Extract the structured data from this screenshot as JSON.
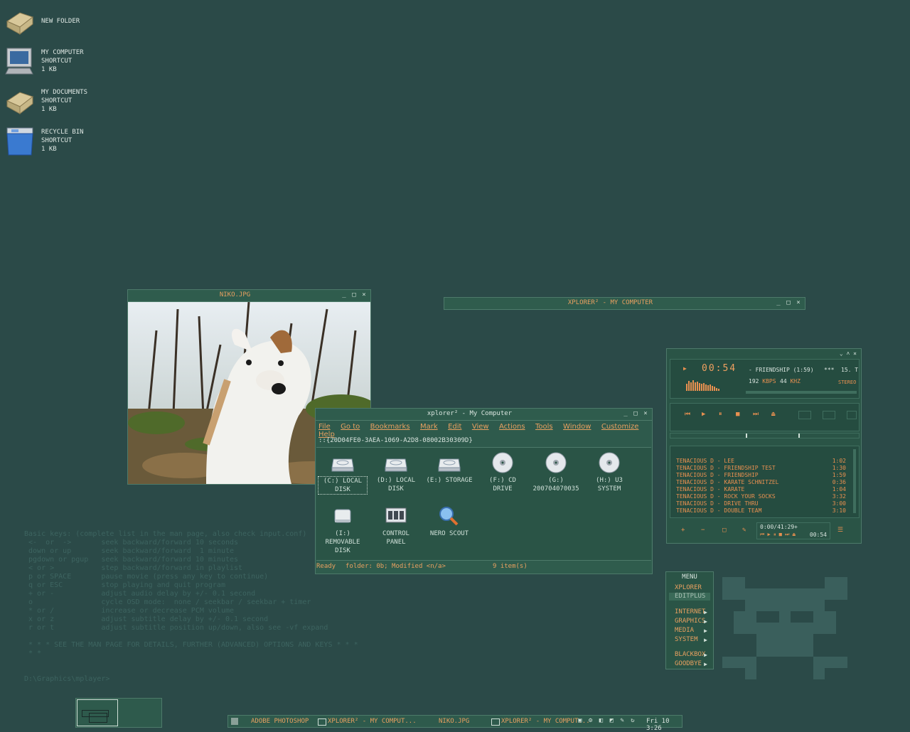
{
  "desktop_icons": [
    {
      "name": "New Folder",
      "lines": [
        "New Folder"
      ]
    },
    {
      "name": "My Computer",
      "lines": [
        "My Computer",
        "Shortcut",
        "1 KB"
      ]
    },
    {
      "name": "My Documents",
      "lines": [
        "My Documents",
        "Shortcut",
        "1 KB"
      ]
    },
    {
      "name": "Recycle Bin",
      "lines": [
        "Recycle Bin",
        "Shortcut",
        "1 KB"
      ]
    }
  ],
  "image_window": {
    "title": "niko.jpg"
  },
  "xplorer_collapsed": {
    "title": "xplorer² - My Computer"
  },
  "xplorer": {
    "title": "xplorer² - My Computer",
    "menu": [
      "File",
      "Go to",
      "Bookmarks",
      "Mark",
      "Edit",
      "View",
      "Actions",
      "Tools",
      "Window",
      "Customize",
      "Help"
    ],
    "address": "::{20D04FE0-3AEA-1069-A2D8-08002B30309D}",
    "drives": [
      {
        "label": "(C:) Local Disk",
        "icon": "hard-drive-icon"
      },
      {
        "label": "(D:) Local Disk",
        "icon": "hard-drive-icon"
      },
      {
        "label": "(E:) Storage",
        "icon": "hard-drive-icon"
      },
      {
        "label": "(F:) CD Drive",
        "icon": "cd-drive-icon"
      },
      {
        "label": "(G:) 200704070035",
        "icon": "cd-drive-icon"
      },
      {
        "label": "(H:) U3 System",
        "icon": "cd-drive-icon"
      },
      {
        "label": "(I:) Removable Disk",
        "icon": "removable-disk-icon"
      },
      {
        "label": "Control Panel",
        "icon": "control-panel-icon"
      },
      {
        "label": "Nero Scout",
        "icon": "nero-scout-icon"
      }
    ],
    "status": {
      "ready": "Ready",
      "folder": "folder: 0b; Modified <n/a>",
      "items": "9 item(s)"
    }
  },
  "winamp": {
    "time": "00:54",
    "track": "- Friendship (1:59)",
    "stars": "***",
    "track_num": "15. T",
    "kbps": "192",
    "kbps_unit": "KBPS",
    "khz": "44",
    "khz_unit": "KHZ",
    "stereo": "STEREO",
    "playlist": [
      {
        "title": "Tenacious D - Lee",
        "dur": "1:02"
      },
      {
        "title": "Tenacious D - Friendship Test",
        "dur": "1:30"
      },
      {
        "title": "Tenacious D - Friendship",
        "dur": "1:59"
      },
      {
        "title": "Tenacious D - Karate Schnitzel",
        "dur": "0:36"
      },
      {
        "title": "Tenacious D - Karate",
        "dur": "1:04"
      },
      {
        "title": "Tenacious D - Rock Your Socks",
        "dur": "3:32"
      },
      {
        "title": "Tenacious D - Drive Thru",
        "dur": "3:00"
      },
      {
        "title": "Tenacious D - Double Team",
        "dur": "3:10"
      }
    ],
    "pl_time": "0:00/41:29+",
    "pl_cur": "00:54",
    "pl_buttons": [
      "+",
      "−",
      "□",
      "✎"
    ]
  },
  "bb_menu": {
    "title": "Menu",
    "top": [
      "xplorer",
      "EditPlus"
    ],
    "items": [
      "Internet",
      "Graphics",
      "Media",
      "System"
    ],
    "bottom": [
      "Blackbox",
      "Goodbye"
    ]
  },
  "console": {
    "header": "Basic keys: (complete list in the man page, also check input.conf)",
    "lines": [
      " <-  or  ->       seek backward/forward 10 seconds",
      " down or up       seek backward/forward  1 minute",
      " pgdown or pgup   seek backward/forward 10 minutes",
      " < or >           step backward/forward in playlist",
      " p or SPACE       pause movie (press any key to continue)",
      " q or ESC         stop playing and quit program",
      " + or -           adjust audio delay by +/- 0.1 second",
      " o                cycle OSD mode:  none / seekbar / seekbar + timer",
      " * or /           increase or decrease PCM volume",
      " x or z           adjust subtitle delay by +/- 0.1 second",
      " r or t           adjust subtitle position up/down, also see -vf expand"
    ],
    "footer1": " * * * SEE THE MAN PAGE FOR DETAILS, FURTHER (ADVANCED) OPTIONS AND KEYS * * *",
    "footer2": " * *",
    "prompt": "D:\\Graphics\\mplayer>"
  },
  "taskbar": {
    "items": [
      "Adobe Photoshop",
      "xplorer² - My Comput...",
      "niko.jpg",
      "xplorer² - My Comput..."
    ],
    "clock": "Fri 10 3:26"
  },
  "colors": {
    "desktop": "#2b4a48",
    "window": "#2e5a4c",
    "accent": "#e8a060"
  }
}
